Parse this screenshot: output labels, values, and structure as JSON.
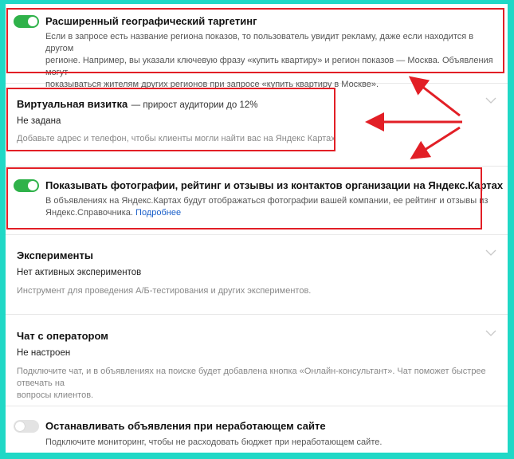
{
  "colors": {
    "background": "#20d8c6",
    "toggle_on": "#2fb24a",
    "toggle_off": "#e3e3e3",
    "highlight": "#e21f26",
    "link": "#1a5fc9"
  },
  "settings": {
    "geo_targeting": {
      "enabled": true,
      "title": "Расширенный географический таргетинг",
      "desc_line1": "Если в запросе есть название региона показов, то пользователь увидит рекламу, даже если находится в другом",
      "desc_line2": "регионе. Например, вы указали ключевую фразу «купить квартиру» и регион показов — Москва. Объявления могут",
      "desc_line3": "показываться жителям других регионов при запросе «купить квартиру в Москве»."
    },
    "business_card": {
      "title": "Виртуальная визитка",
      "title_suffix": "— прирост аудитории до 12%",
      "value": "Не задана",
      "hint": "Добавьте адрес и телефон, чтобы клиенты могли найти вас на Яндекс Картах"
    },
    "show_photos": {
      "enabled": true,
      "title": "Показывать фотографии, рейтинг и отзывы из контактов организации на Яндекс.Картах",
      "desc_line1": "В объявлениях на Яндекс.Картах будут отображаться фотографии вашей компании, ее рейтинг и отзывы из",
      "desc_line2": "Яндекс.Справочника.",
      "link_label": "Подробнее"
    },
    "experiments": {
      "title": "Эксперименты",
      "value": "Нет активных экспериментов",
      "hint": "Инструмент для проведения А/Б-тестирования и других экспериментов."
    },
    "operator_chat": {
      "title": "Чат с оператором",
      "value": "Не настроен",
      "hint_line1": "Подключите чат, и в объявлениях на поиске будет добавлена кнопка «Онлайн-консультант». Чат поможет быстрее отвечать на",
      "hint_line2": "вопросы клиентов."
    },
    "stop_on_site_down": {
      "enabled": false,
      "title": "Останавливать объявления при неработающем сайте",
      "hint": "Подключите мониторинг, чтобы не расходовать бюджет при неработающем сайте."
    }
  }
}
